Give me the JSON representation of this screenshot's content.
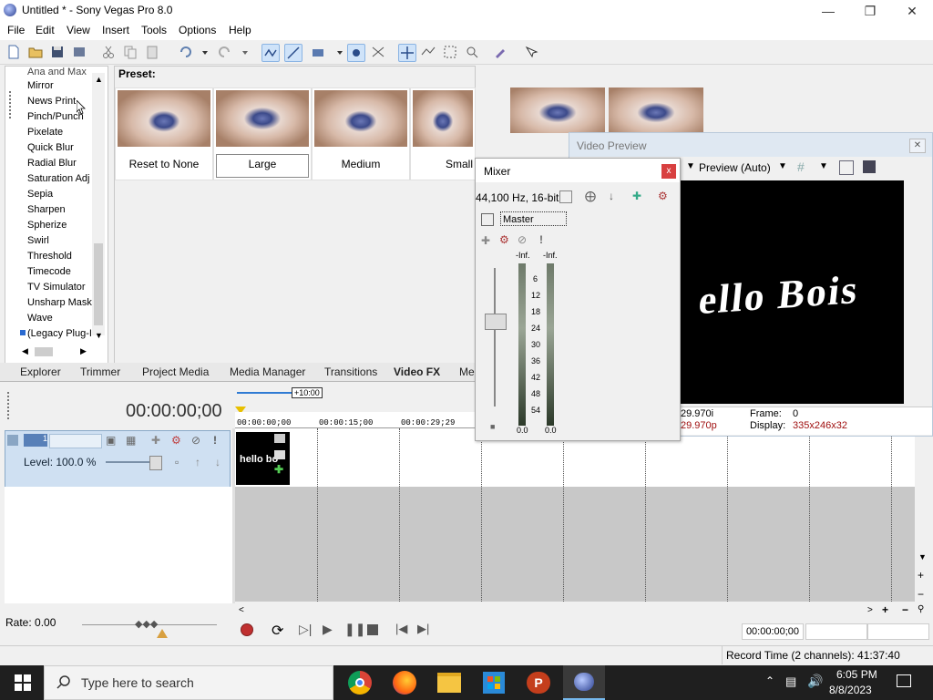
{
  "window": {
    "title": "Untitled * - Sony Vegas Pro 8.0"
  },
  "menu": [
    "File",
    "Edit",
    "View",
    "Insert",
    "Tools",
    "Options",
    "Help"
  ],
  "fx_list": {
    "partial_top": "Ana and Max",
    "items": [
      "Mirror",
      "News Print",
      "Pinch/Punch",
      "Pixelate",
      "Quick Blur",
      "Radial Blur",
      "Saturation Adj",
      "Sepia",
      "Sharpen",
      "Spherize",
      "Swirl",
      "Threshold",
      "Timecode",
      "TV Simulator",
      "Unsharp Mask",
      "Wave",
      "(Legacy Plug-I"
    ]
  },
  "preset": {
    "label": "Preset:",
    "items": [
      "Reset to None",
      "Large",
      "Medium",
      "Small"
    ]
  },
  "tabs": [
    "Explorer",
    "Trimmer",
    "Project Media",
    "Media Manager",
    "Transitions",
    "Video FX",
    "Med"
  ],
  "timeline": {
    "time": "00:00:00;00",
    "marker": "+10:00",
    "ruler": [
      "00:00:00;00",
      "00:00:15;00",
      "00:00:29;29"
    ],
    "track_number": "1",
    "level": "Level: 100.0 %",
    "clip_text": "hello bo"
  },
  "rate": "Rate: 0.00",
  "transport_time": "00:00:00;00",
  "status": {
    "record_time": "Record Time (2 channels): 41:37:40"
  },
  "video_preview": {
    "title": "Video Preview",
    "mode": "Preview (Auto)",
    "screen_text": "ello Bois",
    "info": {
      "project_frag": "29.970i",
      "preview_frag": "29.970p",
      "frame_label": "Frame:",
      "frame_value": "0",
      "display_label": "Display:",
      "display_value": "335x246x32"
    }
  },
  "mixer": {
    "title": "Mixer",
    "close": "x",
    "format": "44,100 Hz, 16-bit",
    "master": "Master",
    "inf_left": "-Inf.",
    "inf_right": "-Inf.",
    "scale": [
      "6",
      "12",
      "18",
      "24",
      "30",
      "36",
      "42",
      "48",
      "54"
    ],
    "value_left": "0.0",
    "value_right": "0.0"
  },
  "taskbar": {
    "search_placeholder": "Type here to search",
    "time": "6:05 PM",
    "date": "8/8/2023"
  },
  "colors": {
    "accent": "#2f7bd3",
    "preview_info_red": "#a01010"
  }
}
